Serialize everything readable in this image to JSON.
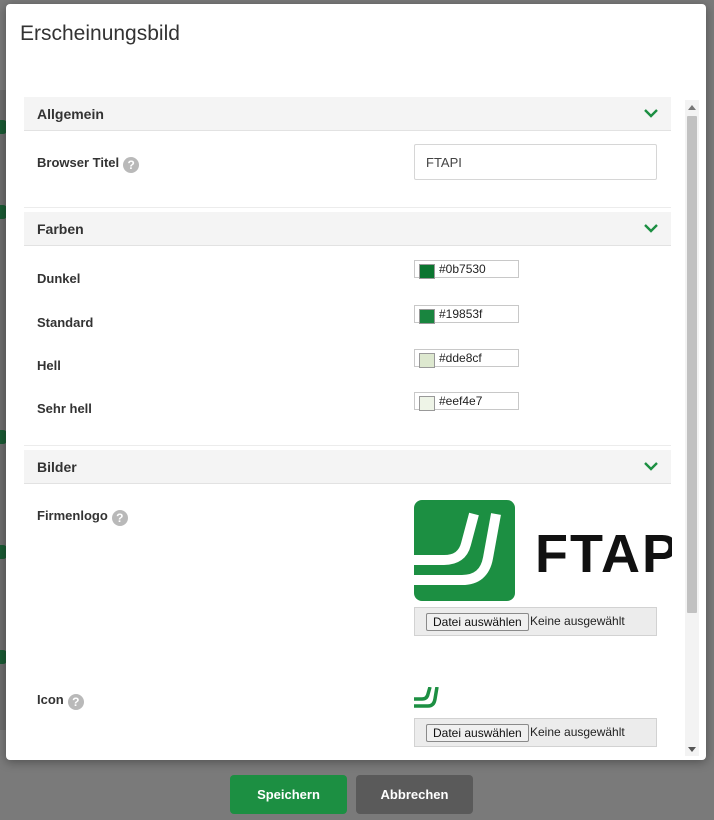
{
  "dialog": {
    "title": "Erscheinungsbild"
  },
  "sections": {
    "general": {
      "title": "Allgemein",
      "browser_title_label": "Browser Titel",
      "browser_title_value": "FTAPI"
    },
    "colors": {
      "title": "Farben",
      "items": [
        {
          "label": "Dunkel",
          "value": "#0b7530",
          "color": "#0b7530"
        },
        {
          "label": "Standard",
          "value": "#19853f",
          "color": "#19853f"
        },
        {
          "label": "Hell",
          "value": "#dde8cf",
          "color": "#dde8cf"
        },
        {
          "label": "Sehr hell",
          "value": "#eef4e7",
          "color": "#eef4e7"
        }
      ]
    },
    "images": {
      "title": "Bilder",
      "logo_label": "Firmenlogo",
      "logo_text": "FTAP",
      "icon_label": "Icon",
      "file_button": "Datei auswählen",
      "file_status": "Keine ausgewählt"
    }
  },
  "footer": {
    "save_label": "Speichern",
    "cancel_label": "Abbrechen"
  },
  "theme": {
    "accent": "#1c8f42",
    "cancel": "#5a5a5a"
  },
  "icons": {
    "help": "?",
    "chevron": "chevron-down-icon"
  }
}
